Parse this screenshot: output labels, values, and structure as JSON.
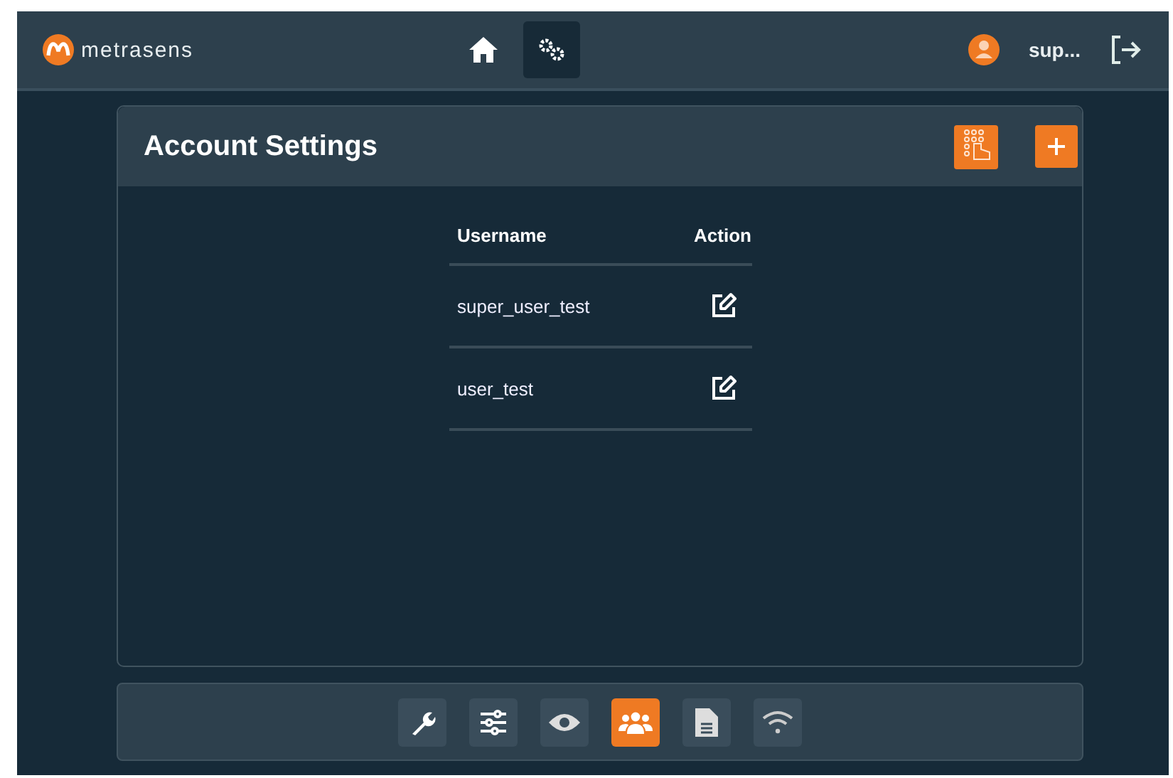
{
  "header": {
    "brand": "metrasens",
    "nav": [
      {
        "kind": "home",
        "selected": false
      },
      {
        "kind": "settings",
        "selected": true
      }
    ],
    "user": "sup..."
  },
  "card": {
    "title": "Account Settings",
    "table": {
      "columns": [
        "Username",
        "Action"
      ],
      "rows": [
        {
          "username": "super_user_test"
        },
        {
          "username": "user_test"
        }
      ]
    }
  },
  "bottom_tabs": [
    {
      "kind": "wrench",
      "selected": false
    },
    {
      "kind": "sliders",
      "selected": false
    },
    {
      "kind": "eye",
      "selected": false
    },
    {
      "kind": "users",
      "selected": true
    },
    {
      "kind": "document",
      "selected": false
    },
    {
      "kind": "wifi",
      "selected": false
    }
  ]
}
